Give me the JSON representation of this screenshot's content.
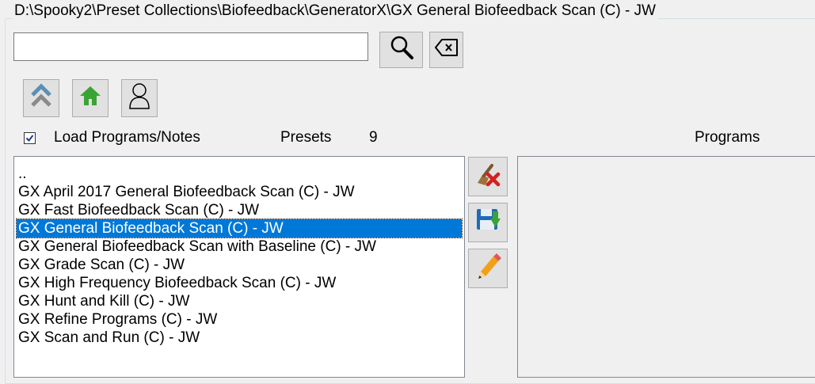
{
  "header": {
    "path": "D:\\Spooky2\\Preset Collections\\Biofeedback\\GeneratorX\\GX General Biofeedback Scan (C) - JW"
  },
  "search": {
    "value": "",
    "placeholder": ""
  },
  "toolbar": {
    "search_icon": "magnifier-icon",
    "clear_icon": "backspace-icon",
    "up_icon": "double-chevron-up-icon",
    "home_icon": "home-icon",
    "user_icon": "user-icon"
  },
  "options": {
    "load_programs_label": "Load Programs/Notes",
    "load_programs_checked": true
  },
  "presets": {
    "label": "Presets",
    "count": "9",
    "items": [
      "..",
      "GX April 2017 General Biofeedback Scan (C) - JW",
      "GX Fast Biofeedback Scan (C) - JW",
      "GX General Biofeedback Scan (C) - JW",
      "GX General Biofeedback Scan with Baseline (C) - JW",
      "GX Grade Scan (C) - JW",
      "GX High Frequency Biofeedback Scan (C) - JW",
      "GX Hunt and Kill (C) - JW",
      "GX Refine Programs (C) - JW",
      "GX Scan and Run (C) - JW"
    ],
    "selected_index": 3
  },
  "side_buttons": {
    "delete_icon": "delete-brush-icon",
    "save_icon": "save-icon",
    "edit_icon": "pencil-icon"
  },
  "programs": {
    "label": "Programs"
  },
  "colors": {
    "selection": "#0078d7",
    "home_green": "#3aa335",
    "save_blue": "#1f6bb5"
  }
}
